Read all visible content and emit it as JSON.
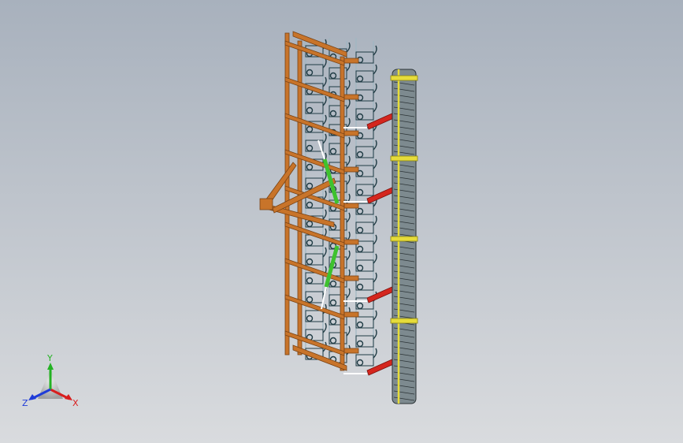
{
  "viewport": {
    "background_top": "#a8b1bd",
    "background_bottom": "#d9dbde"
  },
  "model": {
    "colors": {
      "frame": "#c8742a",
      "frame_dark": "#7a4314",
      "tine": "#1f3b44",
      "tine_light": "#9fb7c2",
      "roller": "#7d8a8f",
      "roller_dark": "#2b3336",
      "roller_band": "#e6dc3a",
      "link": "#d4261e",
      "cylinder": "#3ec22e"
    }
  },
  "triad": {
    "x_label": "X",
    "y_label": "Y",
    "z_label": "Z",
    "x_color": "#d81e1e",
    "y_color": "#23b223",
    "z_color": "#1f3cd8"
  }
}
